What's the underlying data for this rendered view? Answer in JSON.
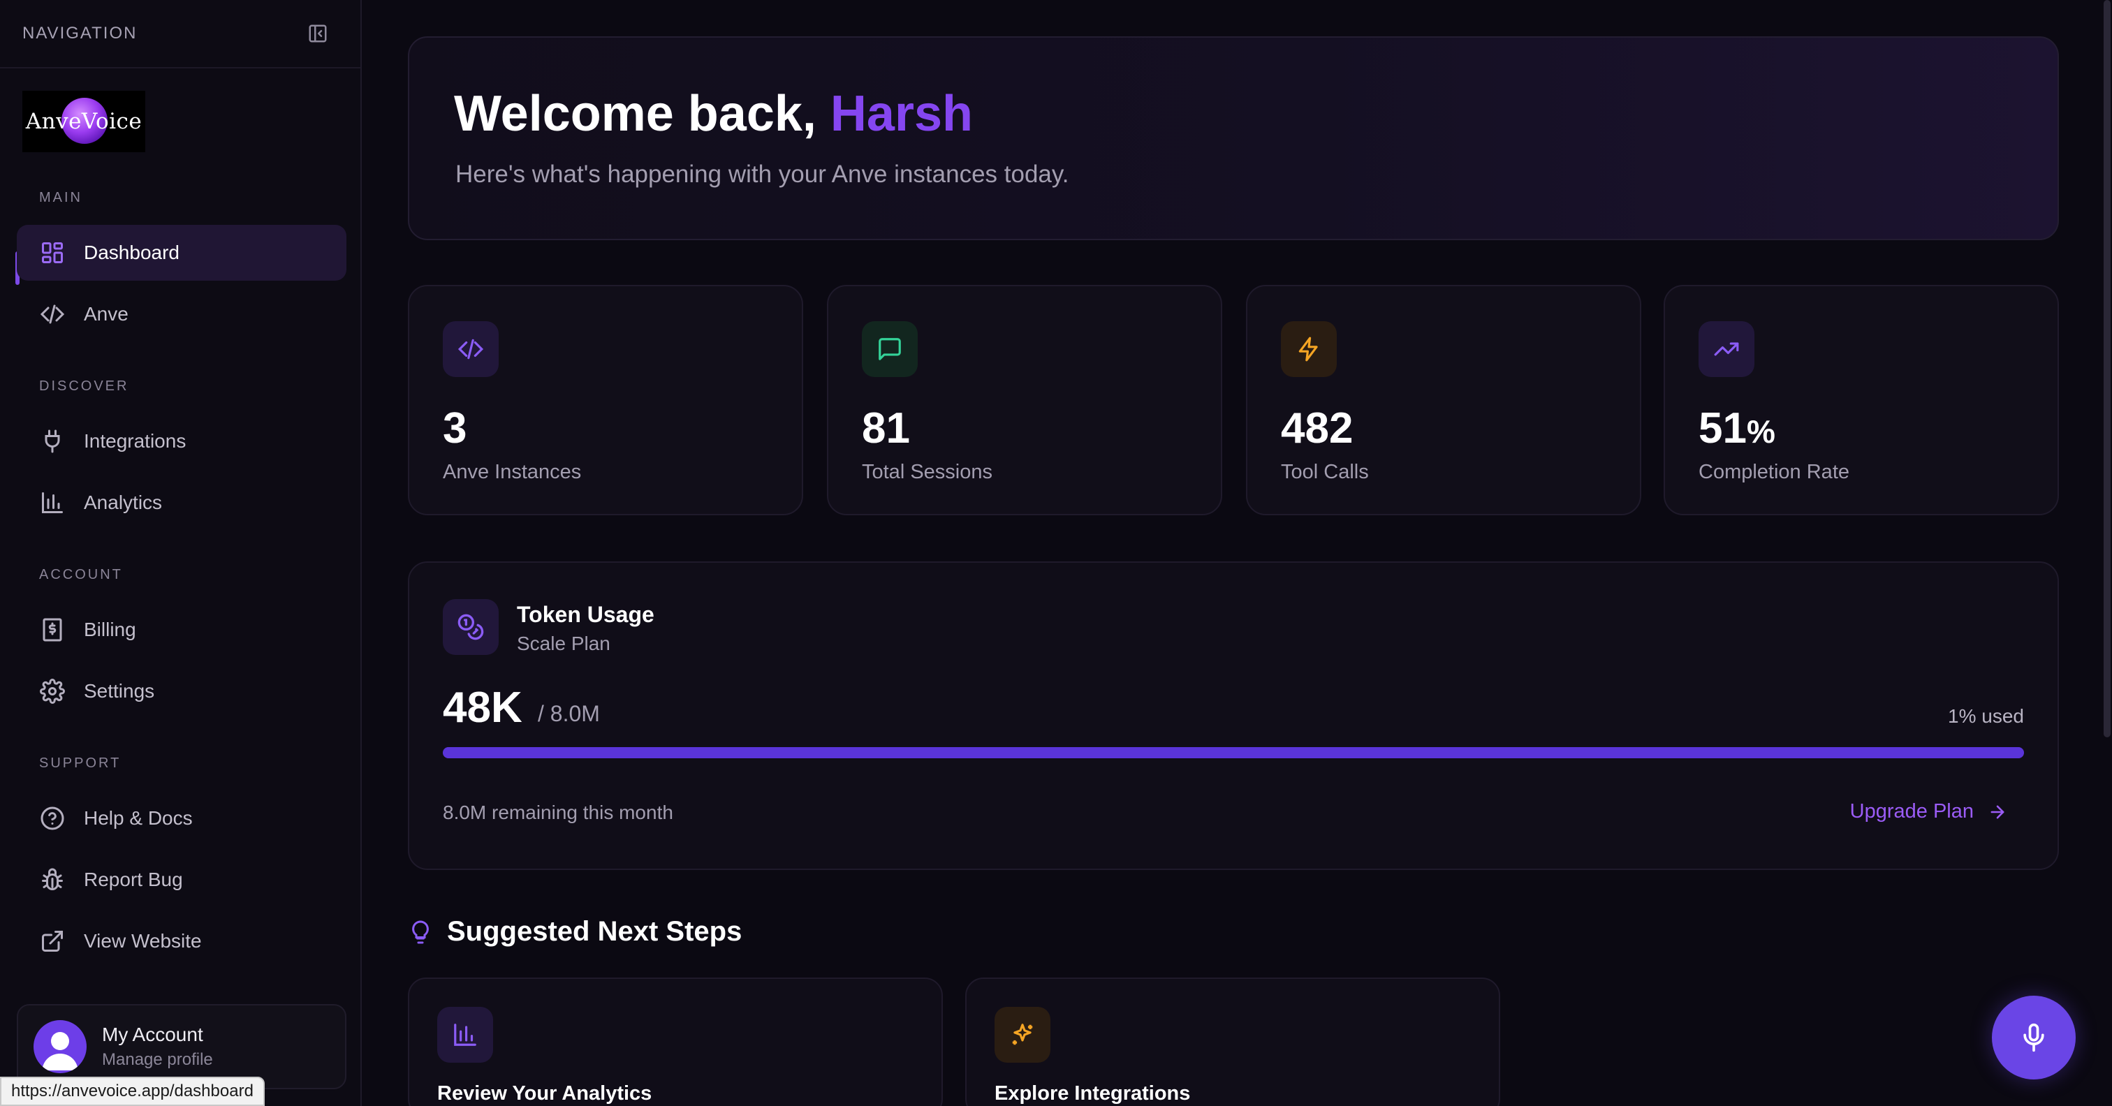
{
  "sidebar": {
    "nav_title": "NAVIGATION",
    "logo_text": "AnveVoice",
    "sections": {
      "main": "MAIN",
      "discover": "DISCOVER",
      "account": "ACCOUNT",
      "support": "SUPPORT"
    },
    "items": {
      "dashboard": "Dashboard",
      "anve": "Anve",
      "integrations": "Integrations",
      "analytics": "Analytics",
      "billing": "Billing",
      "settings": "Settings",
      "help": "Help & Docs",
      "report_bug": "Report Bug",
      "view_website": "View Website"
    },
    "account": {
      "name": "My Account",
      "subtitle": "Manage profile"
    }
  },
  "status_url": "https://anvevoice.app/dashboard",
  "welcome": {
    "greeting": "Welcome back,",
    "name": "Harsh",
    "subtitle": "Here's what's happening with your Anve instances today."
  },
  "stats": [
    {
      "value": "3",
      "label": "Anve Instances",
      "icon": "code-icon",
      "color": "#8b5cf6"
    },
    {
      "value": "81",
      "label": "Total Sessions",
      "icon": "message-icon",
      "color": "#34d399"
    },
    {
      "value": "482",
      "label": "Tool Calls",
      "icon": "bolt-icon",
      "color": "#f5a524"
    },
    {
      "value": "51",
      "suffix": "%",
      "label": "Completion Rate",
      "icon": "trending-up-icon",
      "color": "#8b5cf6"
    }
  ],
  "token_usage": {
    "title": "Token Usage",
    "plan": "Scale Plan",
    "used": "48K",
    "limit": "/ 8.0M",
    "percent_label": "1% used",
    "progress_fraction": 1.0,
    "remaining": "8.0M remaining this month",
    "upgrade_label": "Upgrade Plan"
  },
  "suggested": {
    "title": "Suggested Next Steps",
    "cards": [
      {
        "title": "Review Your Analytics",
        "icon": "bar-chart-icon"
      },
      {
        "title": "Explore Integrations",
        "icon": "sparkles-icon"
      }
    ]
  },
  "colors": {
    "accent": "#8546f0",
    "progress": "#5a34d9",
    "mic_button": "#6a45e6"
  }
}
